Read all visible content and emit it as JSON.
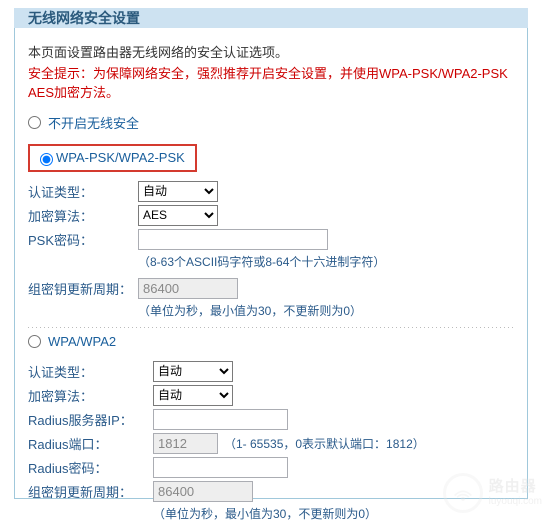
{
  "header": {
    "title": "无线网络安全设置"
  },
  "intro": "本页面设置路由器无线网络的安全认证选项。",
  "warning": "安全提示：为保障网络安全，强烈推荐开启安全设置，并使用WPA-PSK/WPA2-PSK AES加密方法。",
  "options": {
    "none": "不开启无线安全",
    "wpapsk": "WPA-PSK/WPA2-PSK",
    "wpa": "WPA/WPA2"
  },
  "labels": {
    "auth_type": "认证类型：",
    "cipher": "加密算法：",
    "psk": "PSK密码：",
    "group_rekey": "组密钥更新周期：",
    "radius_ip": "Radius服务器IP：",
    "radius_port": "Radius端口：",
    "radius_pwd": "Radius密码："
  },
  "values": {
    "auth_auto": "自动",
    "cipher_aes": "AES",
    "cipher_auto": "自动",
    "psk_value": "",
    "rekey_value": "86400",
    "radius_ip_value": "",
    "radius_port_value": "1812",
    "radius_pwd_value": "",
    "rekey_value2": "86400"
  },
  "hints": {
    "psk": "（8-63个ASCII码字符或8-64个十六进制字符）",
    "rekey": "（单位为秒，最小值为30，不更新则为0）",
    "radius_port": "（1- 65535，0表示默认端口：1812）"
  },
  "watermark": {
    "name": "路由器",
    "domain": "luyouqi.com"
  }
}
